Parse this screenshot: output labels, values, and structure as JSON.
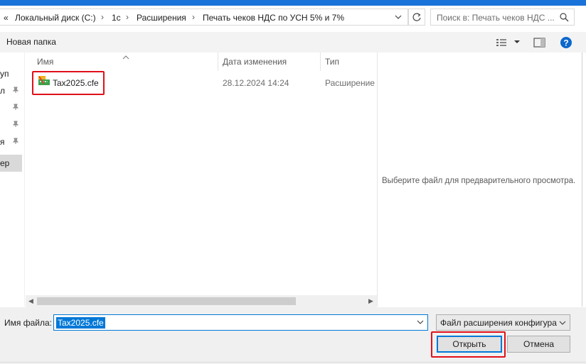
{
  "address": {
    "overflow": "«",
    "crumbs": [
      "Локальный диск (C:)",
      "1с",
      "Расширения",
      "Печать чеков НДС по УСН 5% и 7%"
    ],
    "search_placeholder": "Поиск в: Печать чеков НДС ..."
  },
  "toolbar": {
    "new_folder": "Новая папка"
  },
  "nav": {
    "items": [
      "уп",
      "л",
      "",
      "я",
      "ер"
    ]
  },
  "columns": {
    "name": "Имя",
    "date": "Дата изменения",
    "type": "Тип"
  },
  "files": [
    {
      "name": "Tax2025.cfe",
      "date": "28.12.2024 14:24",
      "type": "Расширение"
    }
  ],
  "preview": {
    "message": "Выберите файл для предварительного просмотра."
  },
  "bottom": {
    "filename_label": "Имя файла:",
    "filename_value": "Tax2025.cfe",
    "filetype_value": "Файл расширения конфигура",
    "open_label": "Открыть",
    "cancel_label": "Отмена"
  },
  "colors": {
    "accent": "#0078d7",
    "highlight_box": "#e0101a"
  }
}
